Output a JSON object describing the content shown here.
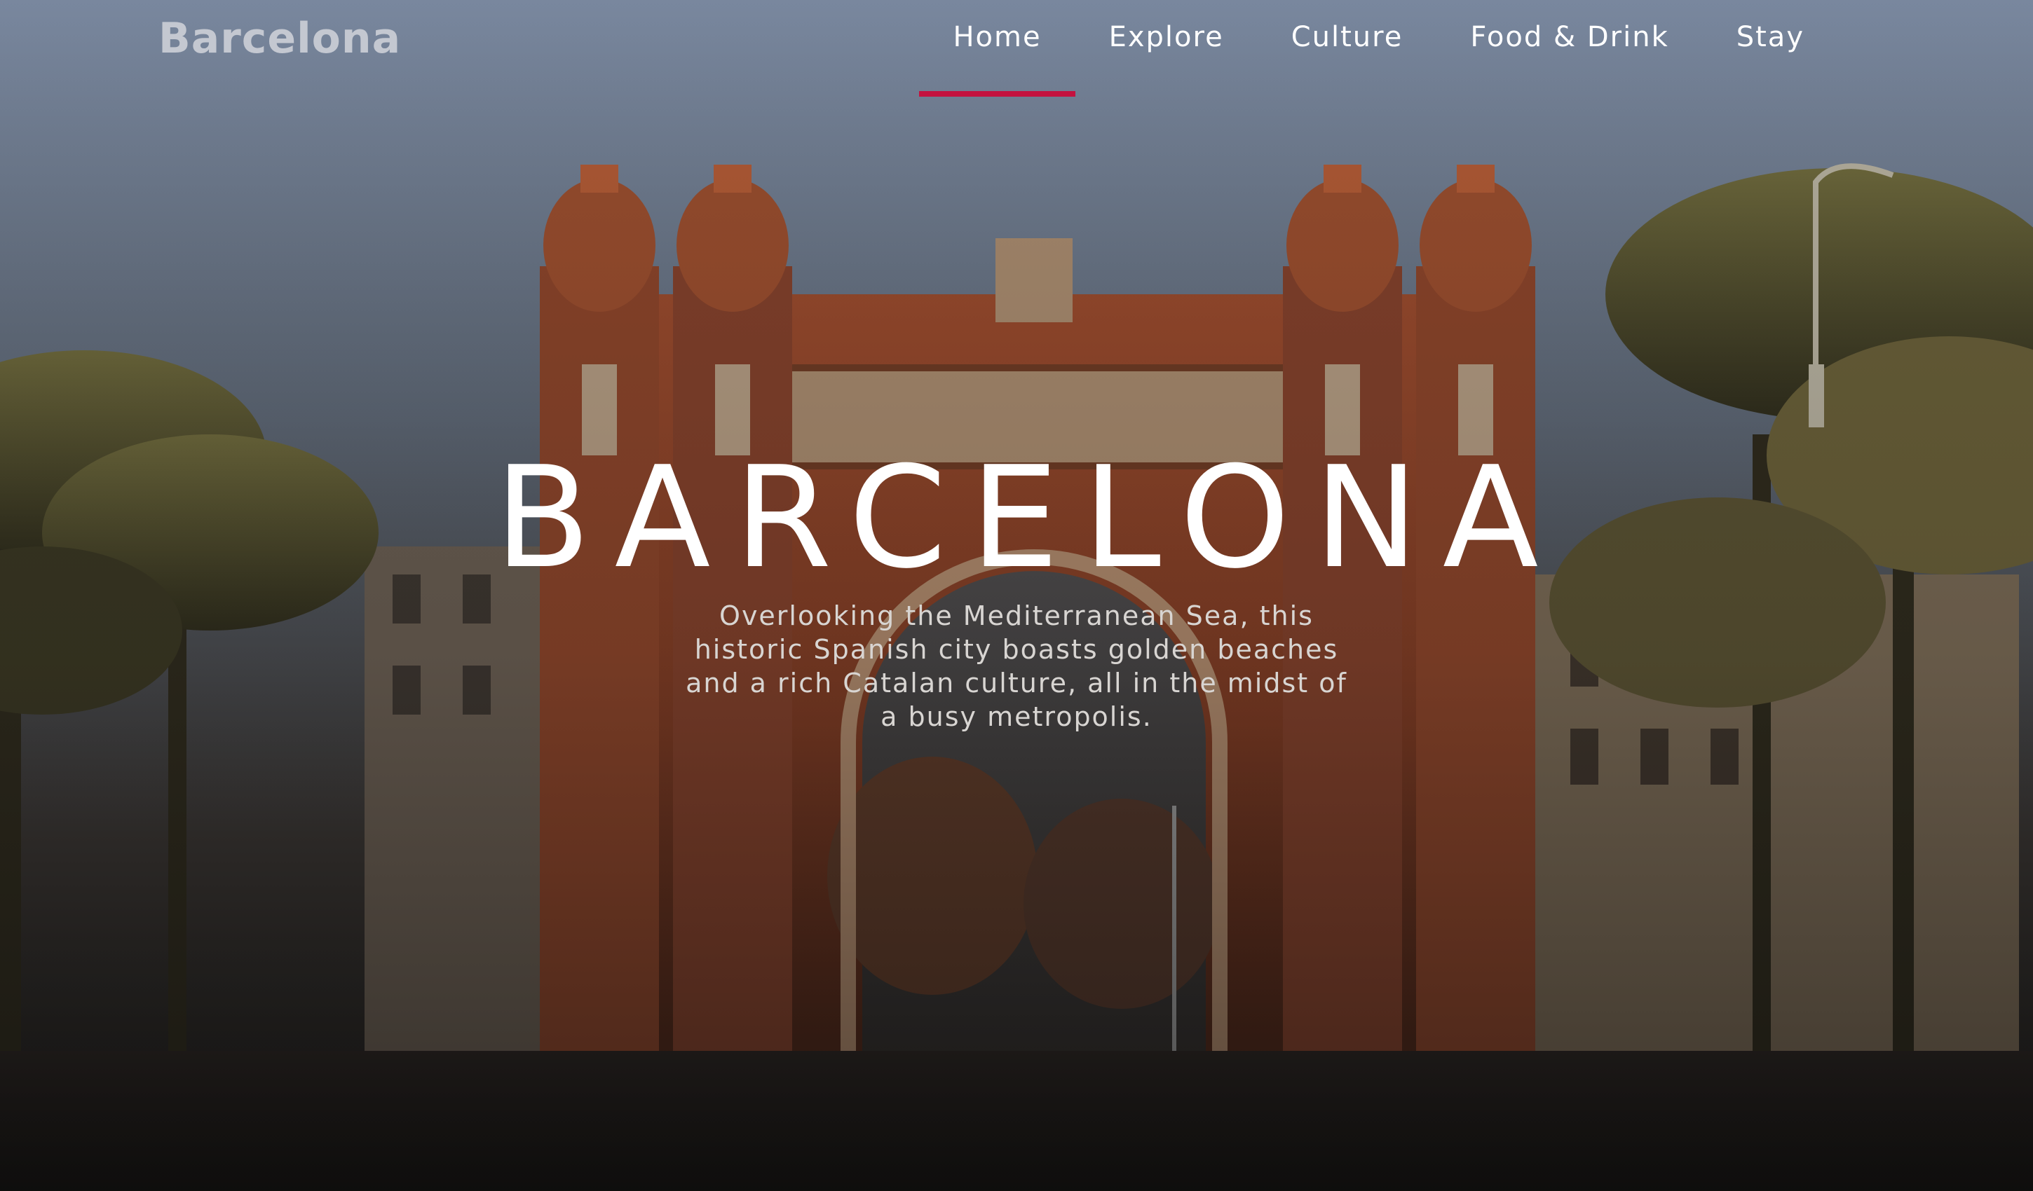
{
  "header": {
    "brand": "Barcelona",
    "nav": [
      {
        "label": "Home",
        "active": true
      },
      {
        "label": "Explore",
        "active": false
      },
      {
        "label": "Culture",
        "active": false
      },
      {
        "label": "Food & Drink",
        "active": false
      },
      {
        "label": "Stay",
        "active": false
      }
    ]
  },
  "hero": {
    "title": "BARCELONA",
    "tagline": "Overlooking the Mediterranean Sea, this historic Spanish city boasts golden beaches and a rich Catalan culture, all in the midst of a busy metropolis."
  },
  "colors": {
    "accent": "#c4123f",
    "brand_text": "#c4c8d1",
    "nav_text": "#ffffff",
    "sky": "#7f8ea6",
    "brick": "#8a3f26"
  }
}
